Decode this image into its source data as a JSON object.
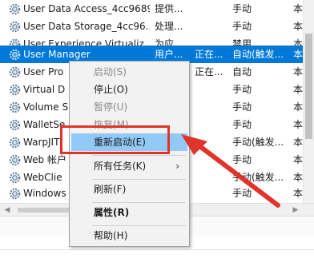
{
  "services": [
    {
      "name": "User Data Access_4cc9689",
      "description": "提供...",
      "status": "",
      "startup": "手动",
      "logon": "本"
    },
    {
      "name": "User Data Storage_4cc96...",
      "description": "处理...",
      "status": "",
      "startup": "手动",
      "logon": "本"
    },
    {
      "name": "User Experience Virtualiz...",
      "description": "为应...",
      "status": "",
      "startup": "禁用",
      "logon": "本"
    },
    {
      "name": "User Manager",
      "description": "用户...",
      "status": "正在...",
      "startup": "自动(触发...",
      "logon": "本"
    },
    {
      "name": "User Pro",
      "description": "",
      "status": "正在...",
      "startup": "自动",
      "logon": "本"
    },
    {
      "name": "Virtual D",
      "description": "",
      "status": "",
      "startup": "手动",
      "logon": "本"
    },
    {
      "name": "Volume S",
      "description": "",
      "status": "",
      "startup": "手动",
      "logon": "本"
    },
    {
      "name": "WalletSe",
      "description": "",
      "status": "",
      "startup": "手动",
      "logon": "本"
    },
    {
      "name": "WarpJIT",
      "description": "",
      "status": "",
      "startup": "手动(触发...",
      "logon": "本"
    },
    {
      "name": "Web 帐户",
      "description": "",
      "status": "",
      "startup": "手动",
      "logon": "本"
    },
    {
      "name": "WebClie",
      "description": "",
      "status": "",
      "startup": "手动(触发...",
      "logon": "本"
    },
    {
      "name": "Windows",
      "description": "",
      "status": "",
      "startup": "手动",
      "logon": "本"
    }
  ],
  "context_menu": {
    "start": "启动(S)",
    "stop": "停止(O)",
    "pause": "暂停(U)",
    "resume": "恢复(M)",
    "restart": "重新启动(E)",
    "all_tasks": "所有任务(K)",
    "refresh": "刷新(F)",
    "properties": "属性(R)",
    "help": "帮助(H)"
  },
  "colors": {
    "selection": "#0078d7",
    "menu_hover": "#91c9f7",
    "annotation": "#e0342a"
  }
}
